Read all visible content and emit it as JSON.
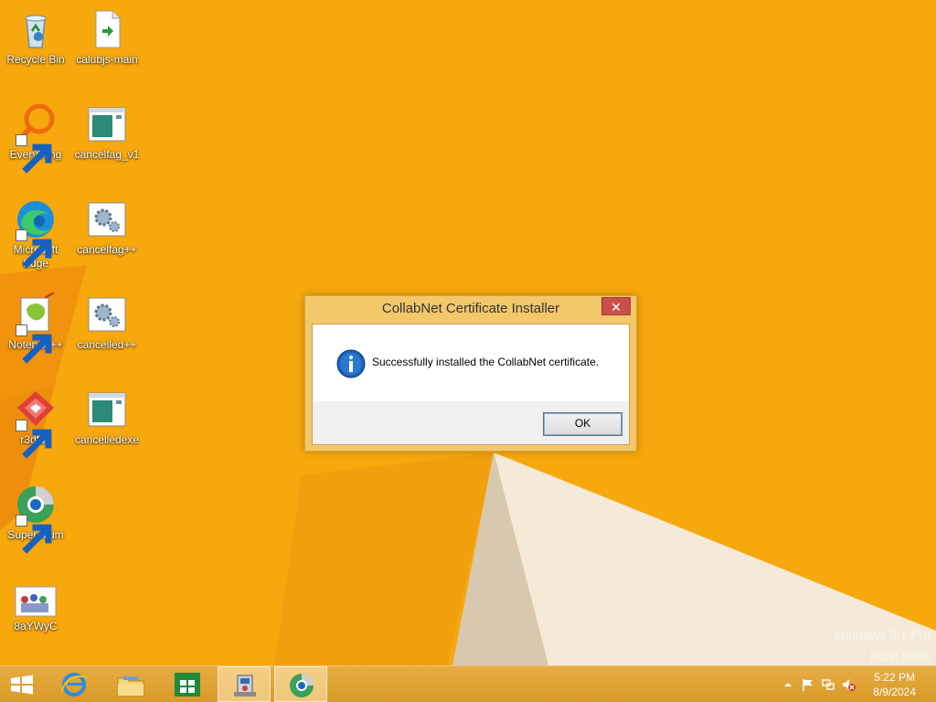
{
  "desktop": {
    "icons": [
      {
        "label": "Recycle Bin",
        "icon": "recycle-bin-icon"
      },
      {
        "label": "calubjs-main",
        "icon": "file-icon"
      },
      {
        "label": "Everything",
        "icon": "everything-search-icon"
      },
      {
        "label": "cancelfag_v1",
        "icon": "app-window-icon"
      },
      {
        "label": "Microsoft Edge",
        "icon": "edge-browser-icon"
      },
      {
        "label": "cancelfag++",
        "icon": "settings-gear-icon"
      },
      {
        "label": "Notepad++",
        "icon": "notepad-plus-plus-icon"
      },
      {
        "label": "cancelled++",
        "icon": "settings-gear-icon"
      },
      {
        "label": "r3dfox",
        "icon": "r3dfox-icon"
      },
      {
        "label": "cancelledexe",
        "icon": "app-window-icon"
      },
      {
        "label": "Supermium",
        "icon": "supermium-icon"
      },
      {
        "label": "8aYWyC",
        "icon": "image-thumbnail-icon"
      }
    ]
  },
  "dialog": {
    "title": "CollabNet Certificate Installer",
    "close_label": "✕",
    "message": "Successfully installed the CollabNet certificate.",
    "ok_label": "OK",
    "icon": "information-icon"
  },
  "watermark": {
    "line1": "Windows 8.1 Pro",
    "line2": "Build 9600"
  },
  "taskbar": {
    "pinned": [
      "start-icon",
      "internet-explorer-icon",
      "file-explorer-icon",
      "store-icon",
      "installer-app-icon",
      "supermium-icon"
    ],
    "tray": {
      "time": "5:22 PM",
      "date": "8/9/2024"
    }
  },
  "colors": {
    "wallpaper": "#f6a80c",
    "taskbar": "#e0a334",
    "close_button": "#c7504b"
  }
}
